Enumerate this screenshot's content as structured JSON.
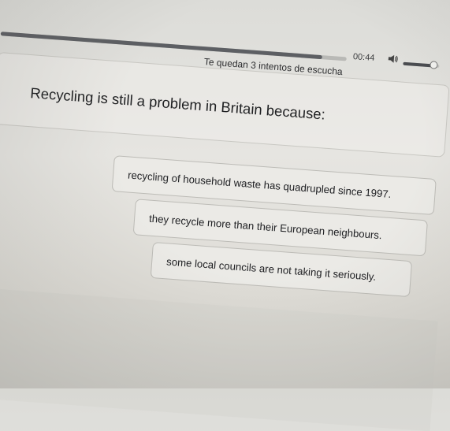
{
  "player": {
    "time": "00:44",
    "progress_fraction": 0.93,
    "volume_fraction": 0.85,
    "volume_icon": "speaker-icon"
  },
  "attempts_text": "Te quedan 3 intentos de escucha",
  "question": {
    "text": "Recycling is still a problem in Britain because:"
  },
  "options": [
    {
      "label": "recycling of household waste has quadrupled since 1997."
    },
    {
      "label": "they recycle more than their European neighbours."
    },
    {
      "label": "some local councils are not taking it seriously."
    }
  ]
}
